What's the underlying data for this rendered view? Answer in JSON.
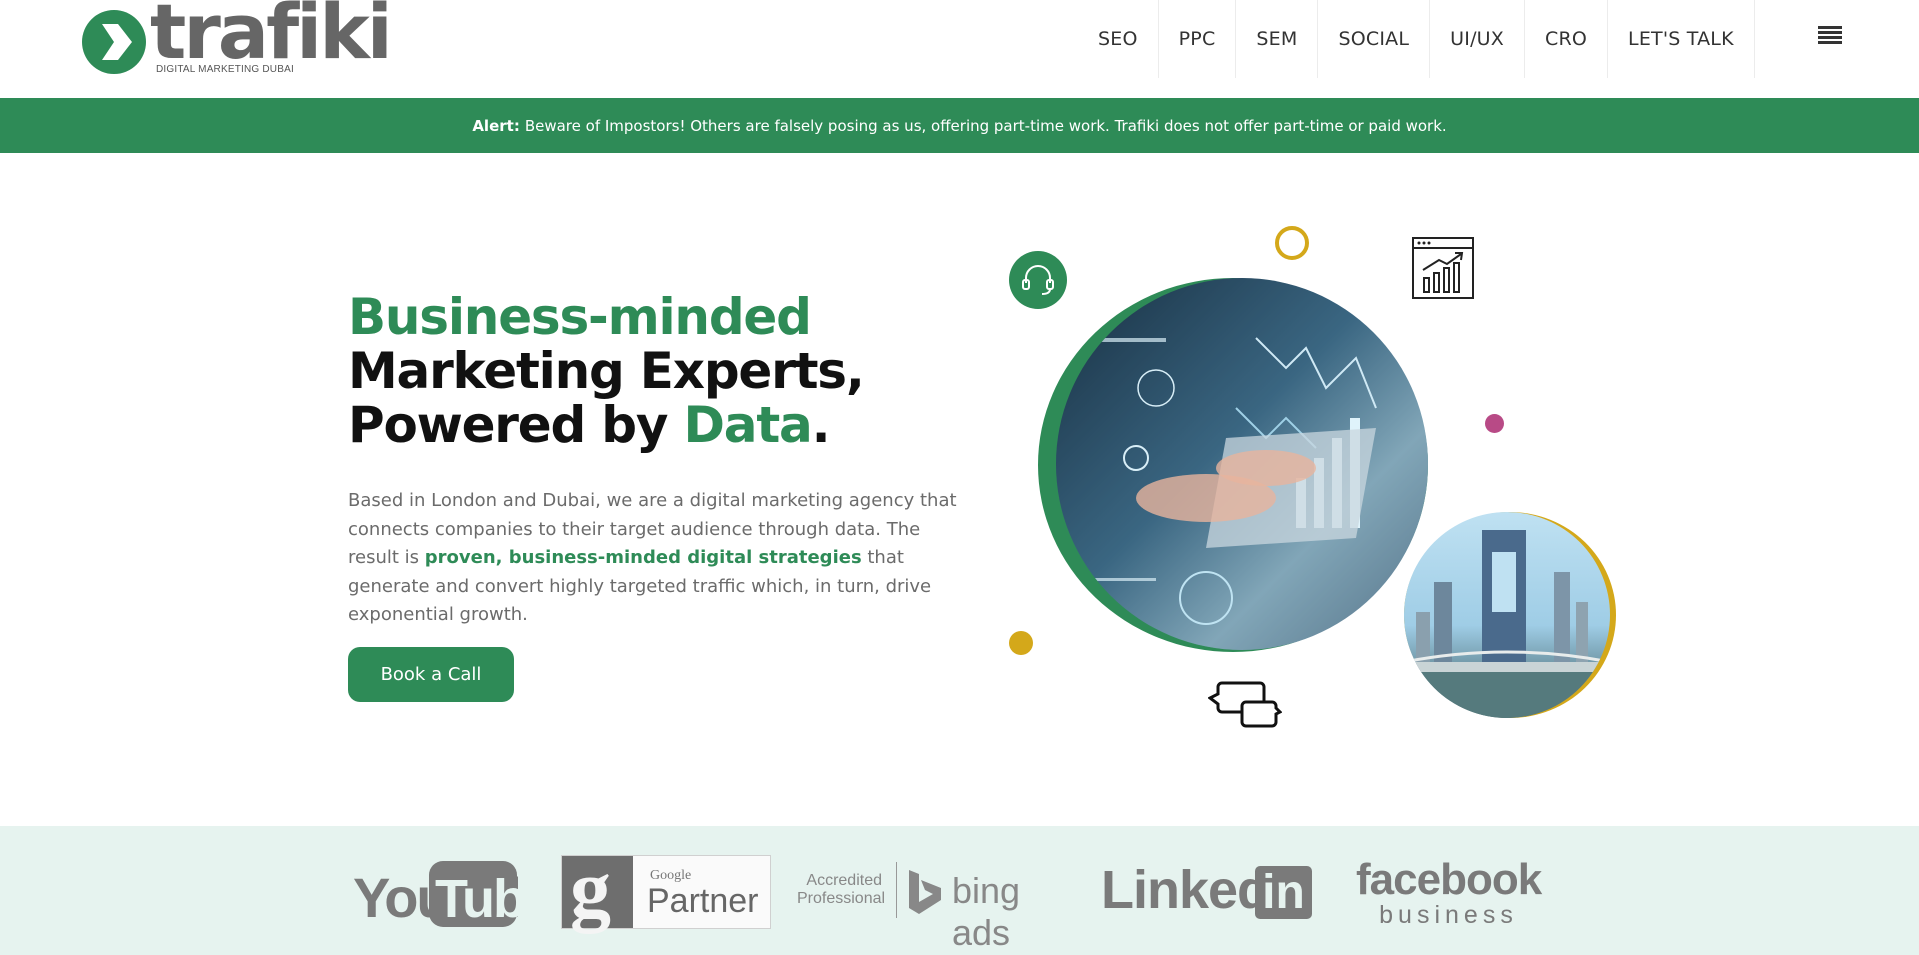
{
  "brand": {
    "name": "trafiki",
    "tagline": "DIGITAL MARKETING DUBAI",
    "primary_color": "#2e8b57",
    "accent_color": "#d4a81a"
  },
  "nav": {
    "items": [
      {
        "label": "SEO"
      },
      {
        "label": "PPC"
      },
      {
        "label": "SEM"
      },
      {
        "label": "SOCIAL"
      },
      {
        "label": "UI/UX"
      },
      {
        "label": "CRO"
      },
      {
        "label": "LET'S TALK"
      }
    ],
    "menu_icon": "hamburger-icon"
  },
  "alert": {
    "label": "Alert:",
    "message": "Beware of Impostors! Others are falsely posing as us, offering part-time work. Trafiki does not offer part-time or paid work."
  },
  "hero": {
    "title_line1": "Business-minded",
    "title_line2": "Marketing Experts,",
    "title_line3_prefix": "Powered by ",
    "title_line3_highlight": "Data",
    "title_line3_suffix": ".",
    "text_before": "Based in London and Dubai, we are a digital marketing agency that connects companies to their target audience through data. The result is ",
    "text_highlight": "proven, business-minded digital strategies",
    "text_after": " that generate and convert highly targeted traffic which, in turn, drive exponential growth.",
    "cta_label": "Book a Call"
  },
  "illustration": {
    "icons": [
      "headset-icon",
      "chart-window-icon",
      "chat-bubbles-icon"
    ],
    "colors": {
      "pink": "#b84a86"
    }
  },
  "partners": {
    "youtube": "YouTube",
    "google_small": "Google",
    "google_big": "Partner",
    "bing_accredited": "Accredited Professional",
    "bing_word": "bing ads",
    "linkedin_text": "Linked",
    "linkedin_box": "in",
    "facebook_top": "facebook",
    "facebook_bottom": "business"
  }
}
